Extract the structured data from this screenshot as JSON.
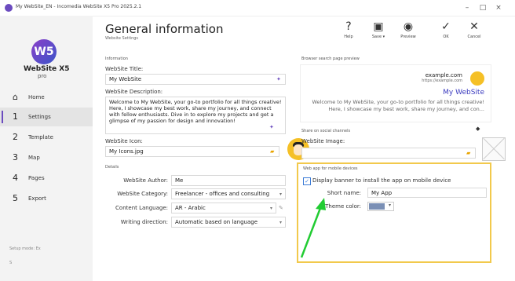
{
  "window": {
    "title": "My WebSite_EN - Incomedia WebSite X5 Pro 2025.2.1"
  },
  "brand": {
    "logo_text": "WebSite X5",
    "logo_sub": "pro",
    "logo_badge": "W5"
  },
  "sidebar": {
    "items": [
      {
        "num": "⌂",
        "label": "Home"
      },
      {
        "num": "1",
        "label": "Settings"
      },
      {
        "num": "2",
        "label": "Template"
      },
      {
        "num": "3",
        "label": "Map"
      },
      {
        "num": "4",
        "label": "Pages"
      },
      {
        "num": "5",
        "label": "Export"
      }
    ],
    "setup_mode": "Setup mode: Ex",
    "setup_foot": "S"
  },
  "header": {
    "title": "General information",
    "subtitle": "Website Settings"
  },
  "toolbar": {
    "help": "Help",
    "save": "Save ▾",
    "preview": "Preview",
    "ok": "OK",
    "cancel": "Cancel"
  },
  "info": {
    "section": "Information",
    "title_label": "WebSite Title:",
    "title_value": "My WebSite",
    "desc_label": "WebSite Description:",
    "desc_value": "Welcome to My WebSite, your go-to portfolio for all things creative! Here, I showcase my best work, share my journey, and connect with fellow enthusiasts. Dive in to explore my projects and get a glimpse of my passion for design and innovation!",
    "icon_label": "WebSite Icon:",
    "icon_value": "My Icons.jpg"
  },
  "details": {
    "section": "Details",
    "author_label": "WebSite Author:",
    "author_value": "Me",
    "category_label": "WebSite Category:",
    "category_value": "Freelancer - offices and consulting",
    "language_label": "Content Language:",
    "language_value": "AR - Arabic",
    "direction_label": "Writing direction:",
    "direction_value": "Automatic based on language"
  },
  "preview": {
    "section": "Browser search page preview",
    "domain": "example.com",
    "url": "https://example.com",
    "title": "My WebSite",
    "desc": "Welcome to My WebSite, your go-to portfolio for all things creative! Here, I showcase my best work, share my journey, and con..."
  },
  "social": {
    "section": "Share on social channels",
    "image_label": "WebSite Image:"
  },
  "mobile": {
    "section": "Web app for mobile devices",
    "checkbox_label": "Display banner to install the app on mobile device",
    "checked": true,
    "short_name_label": "Short name:",
    "short_name_value": "My App",
    "theme_color_label": "Theme color:",
    "theme_color": "#7a8fb5"
  },
  "colors": {
    "accent": "#6b4bbf",
    "highlight": "#f2c94c",
    "arrow": "#22cc33"
  }
}
